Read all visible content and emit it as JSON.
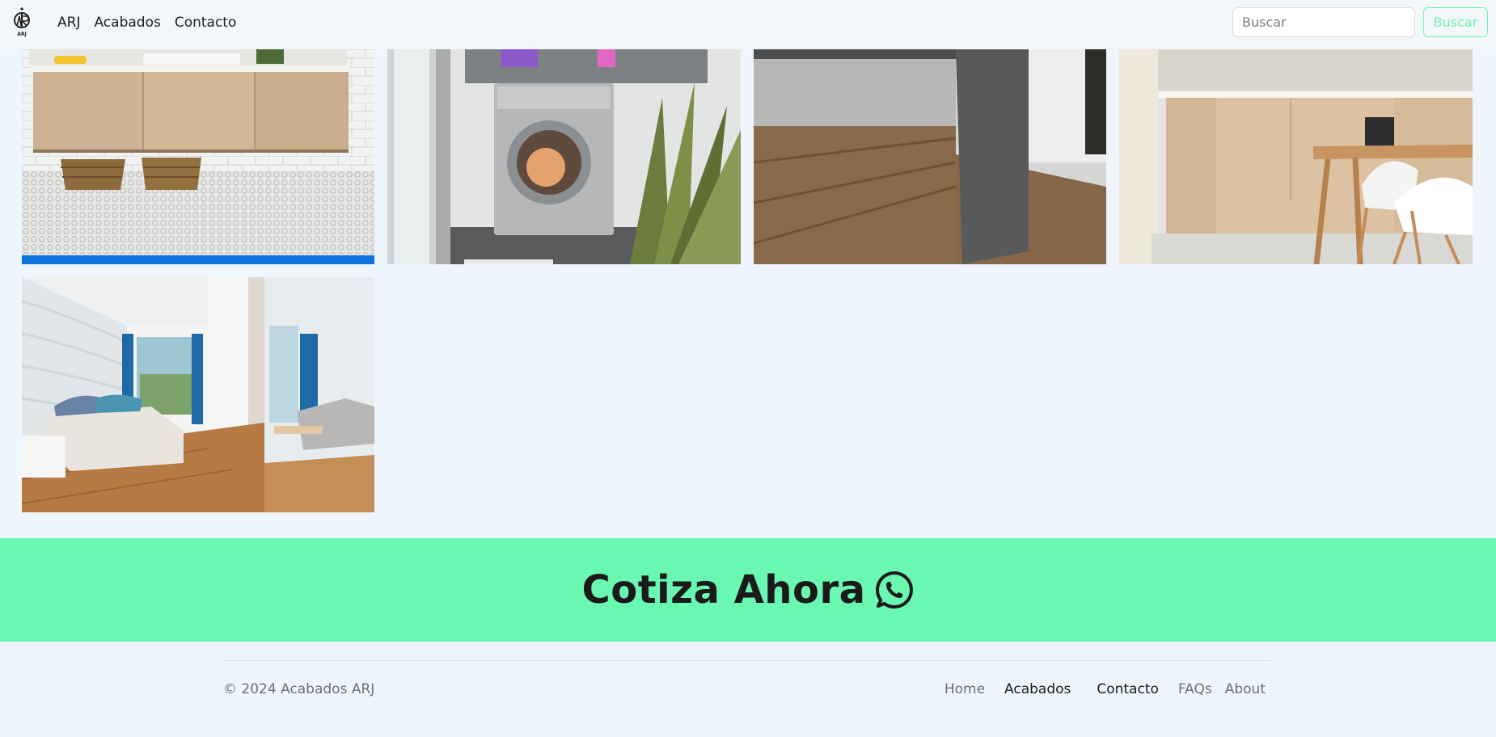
{
  "nav": {
    "logo_text": "ARJ",
    "links": [
      "ARJ",
      "Acabados",
      "Contacto"
    ],
    "search_placeholder": "Buscar",
    "search_button": "Buscar"
  },
  "gallery": {
    "tiles": [
      "bathroom-vanity",
      "laundry-washer",
      "kitchen-island",
      "kitchen-dining",
      "bedroom"
    ]
  },
  "cta": {
    "label": "Cotiza Ahora",
    "icon": "whatsapp-icon",
    "background": "#69f7b2"
  },
  "footer": {
    "copyright": "© 2024 Acabados ARJ",
    "links": [
      "Home",
      "Acabados",
      "Contacto",
      "FAQs",
      "About"
    ]
  },
  "colors": {
    "accent": "#69f7b2",
    "page_bg": "#eef5fc",
    "highlight_bar": "#0d74dd"
  }
}
